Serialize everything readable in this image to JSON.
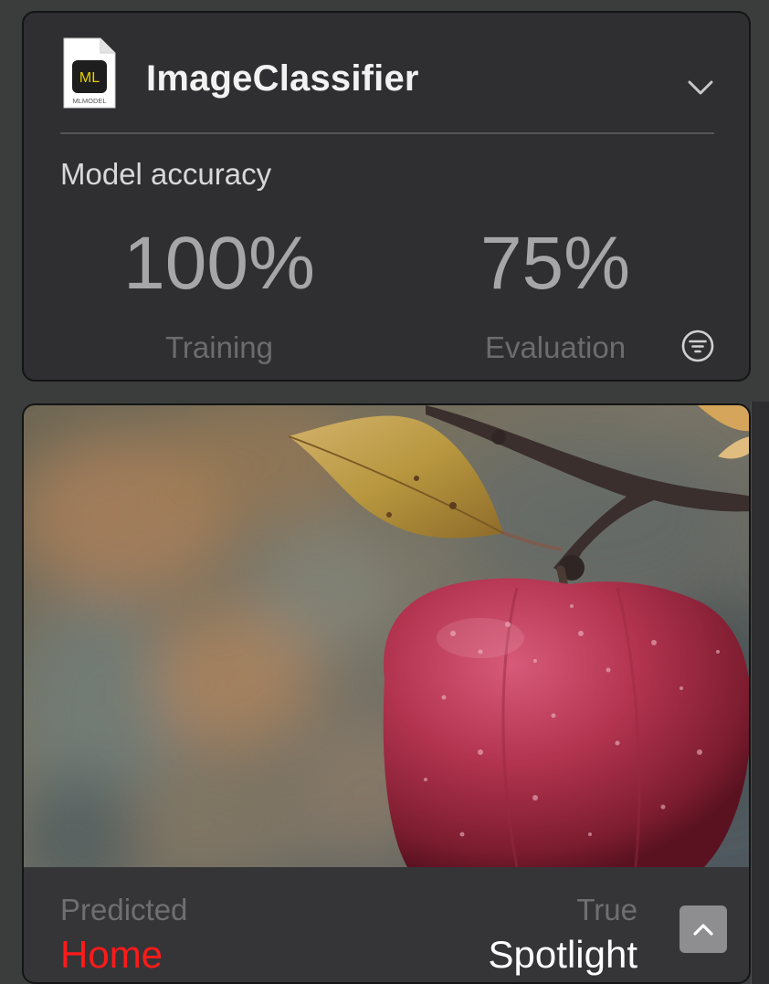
{
  "model": {
    "name": "ImageClassifier",
    "file_icon": {
      "badge": "ML",
      "caption": "MLMODEL",
      "name": "mlmodel-file-icon"
    }
  },
  "accuracy": {
    "title": "Model accuracy",
    "training": {
      "value": "100%",
      "label": "Training"
    },
    "evaluation": {
      "value": "75%",
      "label": "Evaluation"
    }
  },
  "result": {
    "predicted_label": "Predicted",
    "predicted_value": "Home",
    "true_label": "True",
    "true_value": "Spotlight"
  },
  "icons": {
    "expand": "chevron-down-icon",
    "filter": "filter-icon",
    "collapse": "chevron-up-icon"
  },
  "colors": {
    "card_bg": "#2f2f31",
    "predicted_wrong": "#ff1a1a",
    "true_value": "#ffffff",
    "badge_yellow": "#e6d000"
  }
}
